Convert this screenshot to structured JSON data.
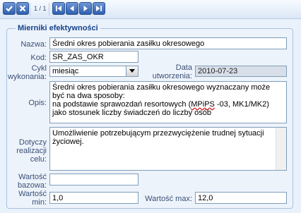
{
  "toolbar": {
    "pager": "1 / 1",
    "buttons": [
      "check-icon",
      "close-icon",
      "first-page-icon",
      "prev-page-icon",
      "next-page-icon",
      "last-page-icon"
    ]
  },
  "form": {
    "legend": "Mierniki efektywności",
    "nazwa_label": "Nazwa:",
    "nazwa_value": "Średni okres pobierania zasiłku okresowego",
    "kod_label": "Kod:",
    "kod_value": "SR_ZAS_OKR",
    "cykl_label_1": "Cykl",
    "cykl_label_2": "wykonania:",
    "cykl_value": "miesiąc",
    "data_label_1": "Data",
    "data_label_2": "utworzenia:",
    "data_value": "2010-07-23",
    "opis_label": "Opis:",
    "opis_line1": "Średni okres pobierania zasiłku okresowego wyznaczany może być na dwa sposoby:",
    "opis_line2_pre": "na podstawie sprawozdań resortowych (",
    "opis_line2_u": "MPiPS",
    "opis_line2_post": " -03, MK1/MK2) jako stosunek liczby świadczeń do liczby osób",
    "cel_label_1": "Dotyczy",
    "cel_label_2": "realizacji",
    "cel_label_3": "celu:",
    "cel_value": "Umożliwienie potrzebującym przezwyciężenie trudnej sytuacji życiowej.",
    "bazowa_label_1": "Wartość",
    "bazowa_label_2": "bazowa:",
    "bazowa_value": "",
    "min_label_1": "Wartość",
    "min_label_2": "min:",
    "min_value": "1,0",
    "max_label": "Wartość max:",
    "max_value": "12,0"
  }
}
